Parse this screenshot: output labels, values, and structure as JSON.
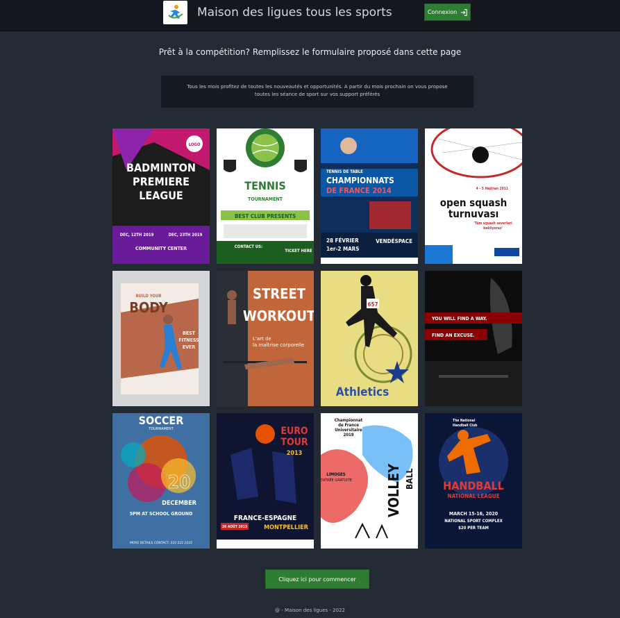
{
  "header": {
    "title": "Maison des ligues tous les sports",
    "login_label": "Connexion",
    "logo_icon": "sport-logo-icon",
    "login_icon": "sign-in-icon"
  },
  "headline": "Prêt à la compétition? Remplissez le formulaire proposé dans cette page",
  "info": {
    "line1": "Tous les mois profitez de toutes les nouveautés et opportunités. A partir du mois prochain on vous propose",
    "line2": "toutes les séance de sport sur vos support préférés"
  },
  "posters": [
    {
      "name": "badminton",
      "lines": [
        "BADMINTON",
        "PREMIERE",
        "LEAGUE",
        "DEC, 12TH 2019",
        "DEC, 23TH 2019",
        "COMMUNITY CENTER"
      ]
    },
    {
      "name": "tennis",
      "lines": [
        "TENNIS",
        "TOURNAMENT",
        "BEST CLUB PRESENTS",
        "CONTACT US:",
        "TICKET HERE"
      ]
    },
    {
      "name": "tennis-de-table",
      "lines": [
        "TENNIS DE TABLE",
        "CHAMPIONNATS",
        "DE FRANCE 2014",
        "28 FÉVRIER",
        "1er-2 MARS",
        "VENDÉSPACE"
      ]
    },
    {
      "name": "squash",
      "lines": [
        "4 - 5 Haziran 2011",
        "open squash",
        "turnuvası",
        "'Tüm squash severleri",
        "bekliyoruz'"
      ]
    },
    {
      "name": "fitness",
      "lines": [
        "BUILD YOUR",
        "BODY",
        "BEST",
        "FITNESS",
        "EVER"
      ]
    },
    {
      "name": "street-workout",
      "lines": [
        "STREET",
        "WORKOUT",
        "L'art de",
        "la maîtrise corporelle"
      ]
    },
    {
      "name": "athletics",
      "lines": [
        "657",
        "Athletics"
      ]
    },
    {
      "name": "gym-motivation",
      "lines": [
        "YOU WILL FIND A WAY.",
        "FIND AN EXCUSE."
      ]
    },
    {
      "name": "soccer",
      "lines": [
        "SOCCER",
        "TOURNAMENT",
        "20",
        "DECEMBER",
        "5PM AT SCHOOL GROUND",
        "MORE DETAILS CONTACT: 222 222 2222"
      ]
    },
    {
      "name": "basketball",
      "lines": [
        "EURO",
        "TOUR",
        "2013",
        "FRANCE-ESPAGNE",
        "MONTPELLIER",
        "26 AOÛT 2013"
      ]
    },
    {
      "name": "volley",
      "lines": [
        "Championnat",
        "de France",
        "Universitaire",
        "2019",
        "VOLLEY",
        "BALL",
        "LIMOGES",
        "ENTRÉE GRATUITE"
      ]
    },
    {
      "name": "handball",
      "lines": [
        "The National",
        "Handball Club",
        "HANDBALL",
        "NATIONAL LEAGUE",
        "MARCH 15-16, 2020",
        "NATIONAL SPORT COMPLEX",
        "$20 PER TEAM"
      ]
    }
  ],
  "start_button": "Cliquez ici pour commencer",
  "footer": "@ - Maison des ligues - 2022",
  "colors": {
    "background": "#242a33",
    "header": "#14181e",
    "button": "#2e7d32"
  }
}
